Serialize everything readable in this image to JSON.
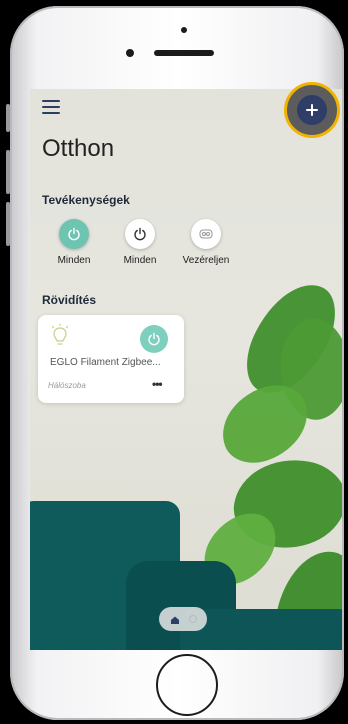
{
  "app": {
    "title": "Otthon"
  },
  "sections": {
    "activities_title": "Tevékenységek",
    "shortcuts_title": "Rövidítés"
  },
  "activities": [
    {
      "label": "Minden",
      "icon": "power-icon",
      "style": "teal"
    },
    {
      "label": "Minden",
      "icon": "power-icon",
      "style": "white"
    },
    {
      "label": "Vezéreljen",
      "icon": "remote-control-icon",
      "style": "white"
    }
  ],
  "shortcut_card": {
    "name": "EGLO Filament Zigbee...",
    "room": "Hálószoba",
    "icon": "lightbulb-icon",
    "more": "•••"
  },
  "colors": {
    "accent_teal": "#7fcfbf",
    "navy": "#2f3e66",
    "highlight": "#f0b400"
  }
}
